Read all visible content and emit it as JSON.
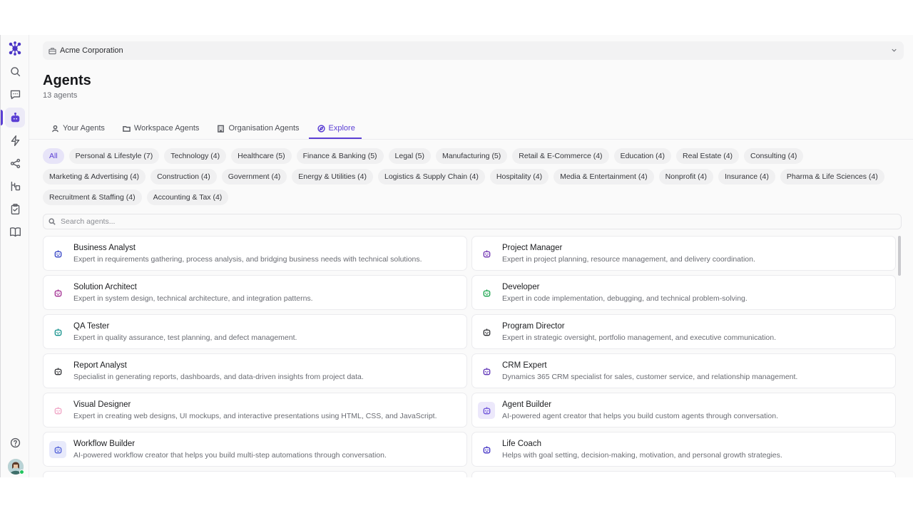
{
  "workspace": {
    "name": "Acme Corporation"
  },
  "page": {
    "title": "Agents",
    "subtitle": "13 agents"
  },
  "tabs": [
    {
      "label": "Your Agents",
      "icon": "user-icon",
      "active": false
    },
    {
      "label": "Workspace Agents",
      "icon": "folder-icon",
      "active": false
    },
    {
      "label": "Organisation Agents",
      "icon": "building-icon",
      "active": false
    },
    {
      "label": "Explore",
      "icon": "compass-icon",
      "active": true
    }
  ],
  "categories": [
    "All",
    "Personal & Lifestyle (7)",
    "Technology (4)",
    "Healthcare (5)",
    "Finance & Banking (5)",
    "Legal (5)",
    "Manufacturing (5)",
    "Retail & E-Commerce (4)",
    "Education (4)",
    "Real Estate (4)",
    "Consulting (4)",
    "Marketing & Advertising (4)",
    "Construction (4)",
    "Government (4)",
    "Energy & Utilities (4)",
    "Logistics & Supply Chain (4)",
    "Hospitality (4)",
    "Media & Entertainment (4)",
    "Nonprofit (4)",
    "Insurance (4)",
    "Pharma & Life Sciences (4)",
    "Recruitment & Staffing (4)",
    "Accounting & Tax (4)"
  ],
  "search": {
    "placeholder": "Search agents..."
  },
  "agents": [
    {
      "name": "Business Analyst",
      "description": "Expert in requirements gathering, process analysis, and bridging business needs with technical solutions.",
      "color": "#2f3fc4",
      "bg": "transparent"
    },
    {
      "name": "Project Manager",
      "description": "Expert in project planning, resource management, and delivery coordination.",
      "color": "#6d2fb0",
      "bg": "transparent"
    },
    {
      "name": "Solution Architect",
      "description": "Expert in system design, technical architecture, and integration patterns.",
      "color": "#a0288f",
      "bg": "transparent"
    },
    {
      "name": "Developer",
      "description": "Expert in code implementation, debugging, and technical problem-solving.",
      "color": "#16a34a",
      "bg": "transparent"
    },
    {
      "name": "QA Tester",
      "description": "Expert in quality assurance, test planning, and defect management.",
      "color": "#0f8f8a",
      "bg": "transparent"
    },
    {
      "name": "Program Director",
      "description": "Expert in strategic oversight, portfolio management, and executive communication.",
      "color": "#2b2c30",
      "bg": "transparent"
    },
    {
      "name": "Report Analyst",
      "description": "Specialist in generating reports, dashboards, and data-driven insights from project data.",
      "color": "#2b2c30",
      "bg": "transparent"
    },
    {
      "name": "CRM Expert",
      "description": "Dynamics 365 CRM specialist for sales, customer service, and relationship management.",
      "color": "#5b2fb5",
      "bg": "transparent"
    },
    {
      "name": "Visual Designer",
      "description": "Expert in creating web designs, UI mockups, and interactive presentations using HTML, CSS, and JavaScript.",
      "color": "#f0a3c4",
      "bg": "transparent"
    },
    {
      "name": "Agent Builder",
      "description": "AI-powered agent creator that helps you build custom agents through conversation.",
      "color": "#6b4fd8",
      "bg": "#ece8fb"
    },
    {
      "name": "Workflow Builder",
      "description": "AI-powered workflow creator that helps you build multi-step automations through conversation.",
      "color": "#4f5fd8",
      "bg": "#e8eafb"
    },
    {
      "name": "Life Coach",
      "description": "Helps with goal setting, decision-making, motivation, and personal growth strategies.",
      "color": "#3f2fc4",
      "bg": "transparent"
    },
    {
      "name": "",
      "description": "",
      "color": "#999999",
      "bg": "transparent"
    },
    {
      "name": "",
      "description": "",
      "color": "#999999",
      "bg": "transparent"
    }
  ],
  "sidebar": {
    "items": [
      {
        "icon": "logo-icon"
      },
      {
        "icon": "search-icon"
      },
      {
        "icon": "chat-icon"
      },
      {
        "icon": "agent-icon",
        "active": true
      },
      {
        "icon": "lightning-icon"
      },
      {
        "icon": "share-icon"
      },
      {
        "icon": "tools-icon"
      },
      {
        "icon": "clipboard-icon"
      },
      {
        "icon": "book-icon"
      },
      {
        "icon": "help-icon"
      }
    ]
  },
  "colors": {
    "accent": "#5b3fd4"
  }
}
